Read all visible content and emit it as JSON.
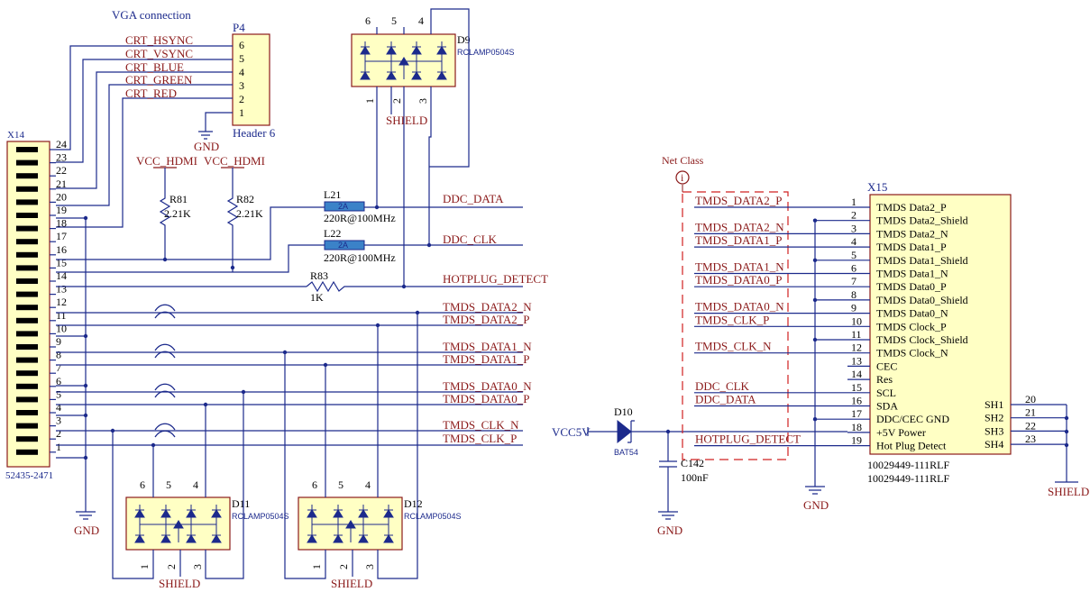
{
  "vga": {
    "title": "VGA connection",
    "header_ref": "P4",
    "header_name": "Header 6",
    "header_pins": [
      "6",
      "5",
      "4",
      "3",
      "2",
      "1"
    ],
    "nets": [
      "CRT_HSYNC",
      "CRT_VSYNC",
      "CRT_BLUE",
      "CRT_GREEN",
      "CRT_RED"
    ],
    "gnd": "GND"
  },
  "x14": {
    "ref": "X14",
    "part": "52435-2471",
    "pins": [
      "24",
      "23",
      "22",
      "21",
      "20",
      "19",
      "18",
      "17",
      "16",
      "15",
      "14",
      "13",
      "12",
      "11",
      "10",
      "9",
      "8",
      "7",
      "6",
      "5",
      "4",
      "3",
      "2",
      "1"
    ],
    "gnd": "GND"
  },
  "resistors": {
    "r81": {
      "ref": "R81",
      "value": "2.21K",
      "supply": "VCC_HDMI"
    },
    "r82": {
      "ref": "R82",
      "value": "2.21K",
      "supply": "VCC_HDMI"
    },
    "r83": {
      "ref": "R83",
      "value": "1K"
    }
  },
  "ferrites": {
    "l21": {
      "ref": "L21",
      "value": "220R@100MHz",
      "badge": "2A"
    },
    "l22": {
      "ref": "L22",
      "value": "220R@100MHz",
      "badge": "2A"
    }
  },
  "nets_mid": [
    "DDC_DATA",
    "DDC_CLK",
    "HOTPLUG_DETECT",
    "TMDS_DATA2_N",
    "TMDS_DATA2_P",
    "TMDS_DATA1_N",
    "TMDS_DATA1_P",
    "TMDS_DATA0_N",
    "TMDS_DATA0_P",
    "TMDS_CLK_N",
    "TMDS_CLK_P"
  ],
  "tvs": {
    "d9": {
      "ref": "D9",
      "part": "RCLAMP0504S",
      "pins_top": [
        "6",
        "5",
        "4"
      ],
      "pins_bottom": [
        "1",
        "2",
        "3"
      ],
      "shield": "SHIELD"
    },
    "d11": {
      "ref": "D11",
      "part": "RCLAMP0504S",
      "pins_top": [
        "6",
        "5",
        "4"
      ],
      "pins_bottom": [
        "1",
        "2",
        "3"
      ],
      "shield": "SHIELD"
    },
    "d12": {
      "ref": "D12",
      "part": "RCLAMP0504S",
      "pins_top": [
        "6",
        "5",
        "4"
      ],
      "pins_bottom": [
        "1",
        "2",
        "3"
      ],
      "shield": "SHIELD"
    }
  },
  "power": {
    "vcc5v": "VCC5V",
    "d10_ref": "D10",
    "d10_part": "BAT54",
    "c142_ref": "C142",
    "c142_value": "100nF",
    "gnd": "GND"
  },
  "netclass": {
    "label": "Net Class",
    "icon": "info-icon"
  },
  "x15": {
    "ref": "X15",
    "part1": "10029449-111RLF",
    "part2": "10029449-111RLF",
    "pins": [
      {
        "num": "1",
        "name": "TMDS Data2_P",
        "net": "TMDS_DATA2_P"
      },
      {
        "num": "2",
        "name": "TMDS Data2_Shield",
        "net": ""
      },
      {
        "num": "3",
        "name": "TMDS Data2_N",
        "net": "TMDS_DATA2_N"
      },
      {
        "num": "4",
        "name": "TMDS Data1_P",
        "net": "TMDS_DATA1_P"
      },
      {
        "num": "5",
        "name": "TMDS Data1_Shield",
        "net": ""
      },
      {
        "num": "6",
        "name": "TMDS Data1_N",
        "net": "TMDS_DATA1_N"
      },
      {
        "num": "7",
        "name": "TMDS Data0_P",
        "net": "TMDS_DATA0_P"
      },
      {
        "num": "8",
        "name": "TMDS Data0_Shield",
        "net": ""
      },
      {
        "num": "9",
        "name": "TMDS Data0_N",
        "net": "TMDS_DATA0_N"
      },
      {
        "num": "10",
        "name": "TMDS Clock_P",
        "net": "TMDS_CLK_P"
      },
      {
        "num": "11",
        "name": "TMDS Clock_Shield",
        "net": ""
      },
      {
        "num": "12",
        "name": "TMDS Clock_N",
        "net": "TMDS_CLK_N"
      },
      {
        "num": "13",
        "name": "CEC",
        "net": ""
      },
      {
        "num": "14",
        "name": "Res",
        "net": ""
      },
      {
        "num": "15",
        "name": "SCL",
        "net": "DDC_CLK"
      },
      {
        "num": "16",
        "name": "SDA",
        "net": "DDC_DATA"
      },
      {
        "num": "17",
        "name": "DDC/CEC GND",
        "net": ""
      },
      {
        "num": "18",
        "name": "+5V Power",
        "net": ""
      },
      {
        "num": "19",
        "name": "Hot Plug Detect",
        "net": "HOTPLUG_DETECT"
      }
    ],
    "shield_pins": [
      {
        "num": "20",
        "name": "SH1"
      },
      {
        "num": "21",
        "name": "SH2"
      },
      {
        "num": "22",
        "name": "SH3"
      },
      {
        "num": "23",
        "name": "SH4"
      }
    ],
    "gnd": "GND",
    "shield": "SHIELD"
  }
}
